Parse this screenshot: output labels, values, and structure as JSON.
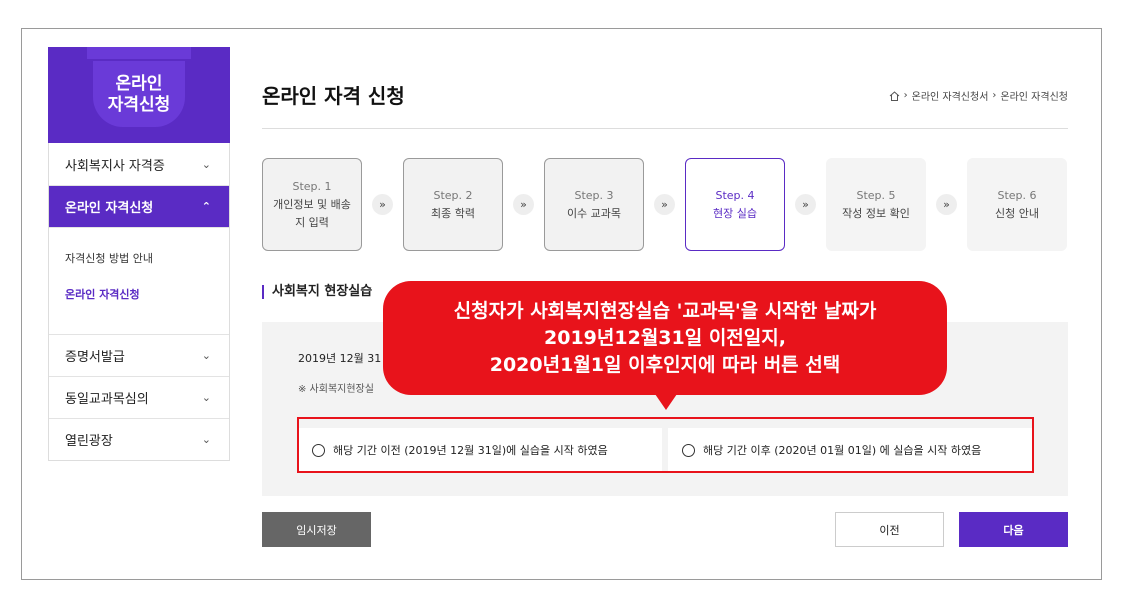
{
  "sidebar": {
    "hero_title_line1": "온라인",
    "hero_title_line2": "자격신청",
    "items": [
      {
        "label": "사회복지사 자격증",
        "chevron": "⌄"
      },
      {
        "label": "온라인 자격신청",
        "chevron": "⌃"
      },
      {
        "label": "증명서발급",
        "chevron": "⌄"
      },
      {
        "label": "동일교과목심의",
        "chevron": "⌄"
      },
      {
        "label": "열린광장",
        "chevron": "⌄"
      }
    ],
    "sub_items": [
      "자격신청 방법 안내",
      "온라인 자격신청"
    ]
  },
  "header": {
    "title": "온라인 자격 신청",
    "breadcrumb": [
      "온라인 자격신청서",
      "온라인 자격신청"
    ]
  },
  "steps": [
    {
      "num": "Step. 1",
      "label": "개인정보 및 배송지 입력"
    },
    {
      "num": "Step. 2",
      "label": "최종 학력"
    },
    {
      "num": "Step. 3",
      "label": "이수 교과목"
    },
    {
      "num": "Step. 4",
      "label": "현장 실습"
    },
    {
      "num": "Step. 5",
      "label": "작성 정보 확인"
    },
    {
      "num": "Step. 6",
      "label": "신청 안내"
    }
  ],
  "section": {
    "title": "사회복지 현장실습",
    "question": "2019년 12월 31",
    "note": "※ 사회복지현장실",
    "option_before": "해당 기간 이전 (2019년 12월 31일)에 실습을 시작 하였음",
    "option_after": "해당 기간 이후 (2020년 01월 01일) 에 실습을 시작 하였음"
  },
  "buttons": {
    "save": "임시저장",
    "prev": "이전",
    "next": "다음"
  },
  "callout": {
    "line1": "신청자가 사회복지현장실습 '교과목'을 시작한 날짜가",
    "line2": "2019년12월31일 이전일지,",
    "line3": "2020년1월1일 이후인지에 따라 버튼 선택"
  },
  "colors": {
    "accent": "#5a2bc4",
    "callout": "#e8131b"
  }
}
